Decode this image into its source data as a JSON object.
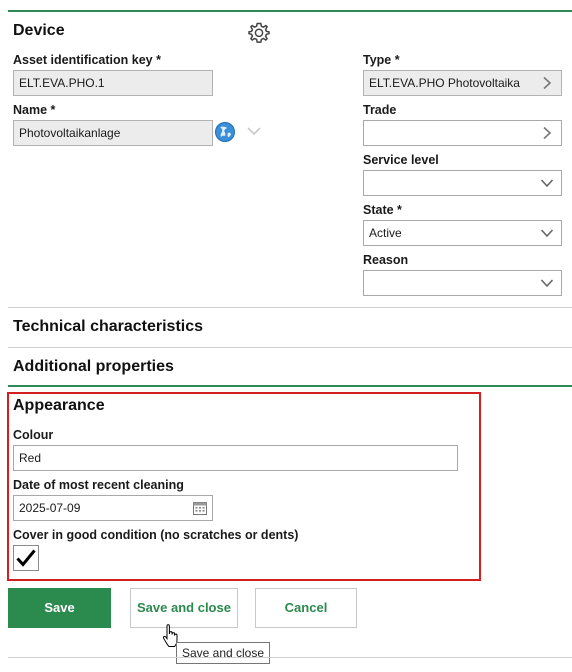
{
  "device": {
    "title": "Device",
    "asset_key": {
      "label": "Asset identification key *",
      "value": "ELT.EVA.PHO.1"
    },
    "name": {
      "label": "Name *",
      "value": "Photovoltaikanlage"
    },
    "type": {
      "label": "Type *",
      "value": "ELT.EVA.PHO Photovoltaika"
    },
    "trade": {
      "label": "Trade",
      "value": ""
    },
    "service_level": {
      "label": "Service level",
      "value": ""
    },
    "state": {
      "label": "State *",
      "value": "Active"
    },
    "reason": {
      "label": "Reason",
      "value": ""
    }
  },
  "sections": {
    "technical": "Technical characteristics",
    "additional": "Additional properties"
  },
  "appearance": {
    "title": "Appearance",
    "colour": {
      "label": "Colour",
      "value": "Red"
    },
    "cleaning_date": {
      "label": "Date of most recent cleaning",
      "value": "2025-07-09"
    },
    "cover": {
      "label": "Cover in good condition (no scratches or dents)",
      "checked": true
    }
  },
  "actions": {
    "save": "Save",
    "save_close": "Save and close",
    "cancel": "Cancel"
  },
  "tooltip": "Save and close",
  "colors": {
    "accent": "#2b8a4e",
    "highlight": "#d21f1f"
  }
}
